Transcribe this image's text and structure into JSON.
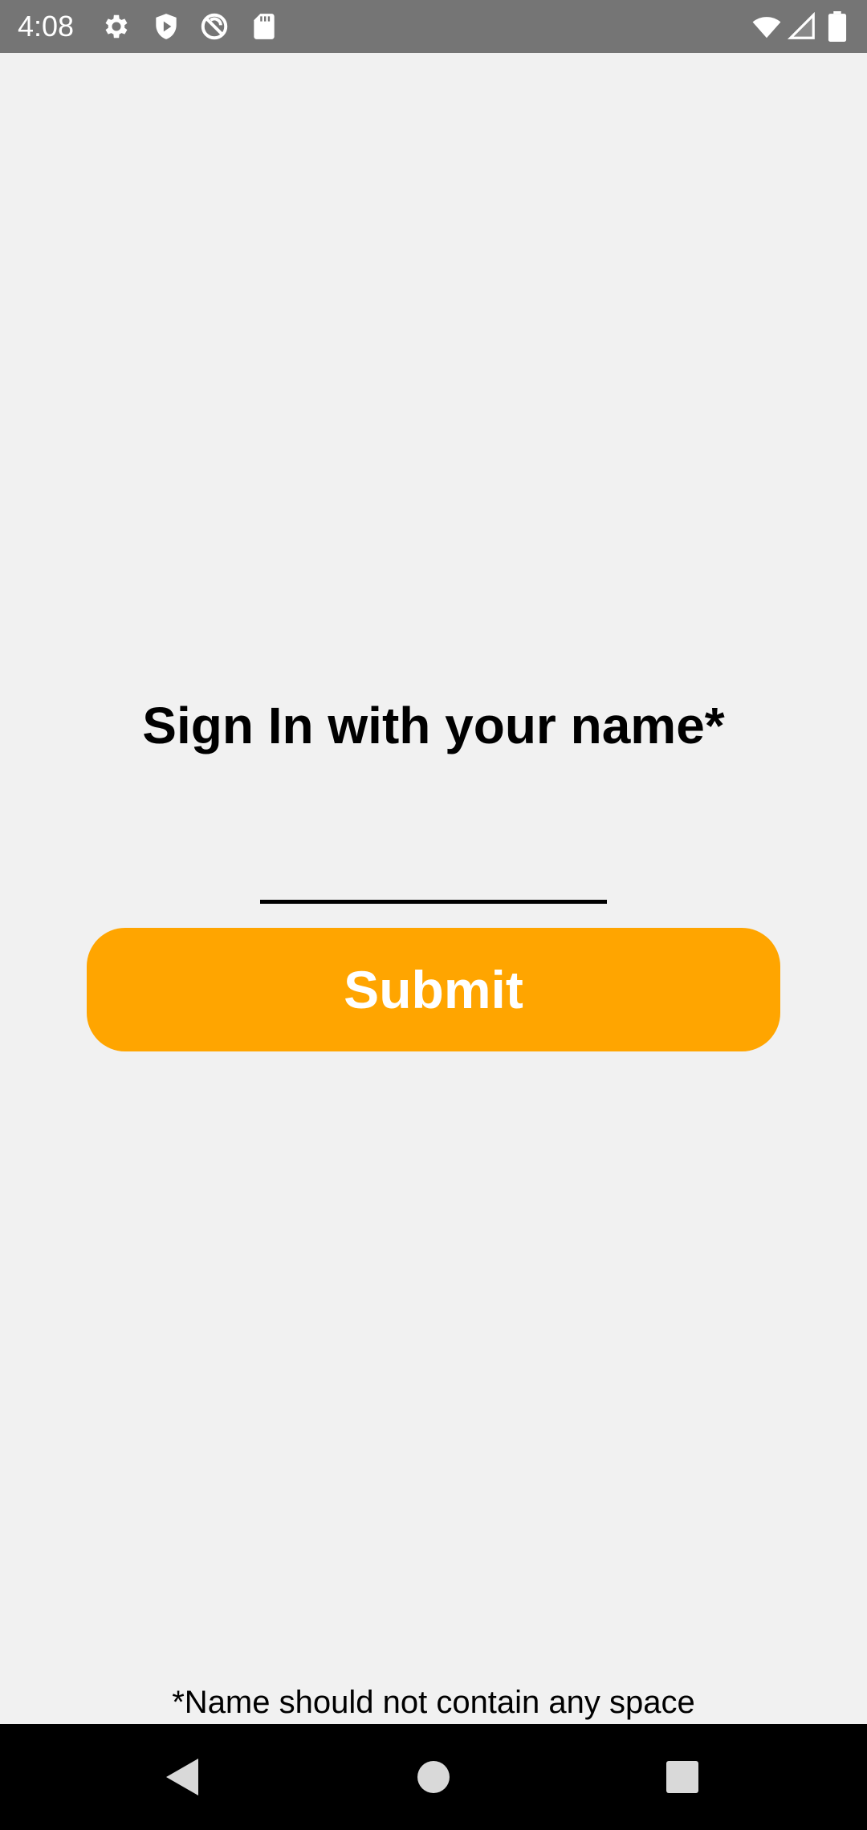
{
  "status_bar": {
    "time": "4:08",
    "left_icons": [
      "gear-icon",
      "play-protect-icon",
      "no-sync-icon",
      "sd-card-icon"
    ],
    "right_icons": [
      "wifi-icon",
      "signal-icon",
      "battery-icon"
    ],
    "background": "#757575"
  },
  "sign_in": {
    "title": "Sign In with your name*",
    "name_input_value": "",
    "name_input_placeholder": "",
    "submit_label": "Submit",
    "footnote": "*Name should not contain any space"
  },
  "colors": {
    "background": "#f1f1f1",
    "accent": "#ffa500",
    "text": "#000000"
  },
  "nav_bar": {
    "buttons": [
      "back-icon",
      "home-icon",
      "recents-icon"
    ]
  }
}
